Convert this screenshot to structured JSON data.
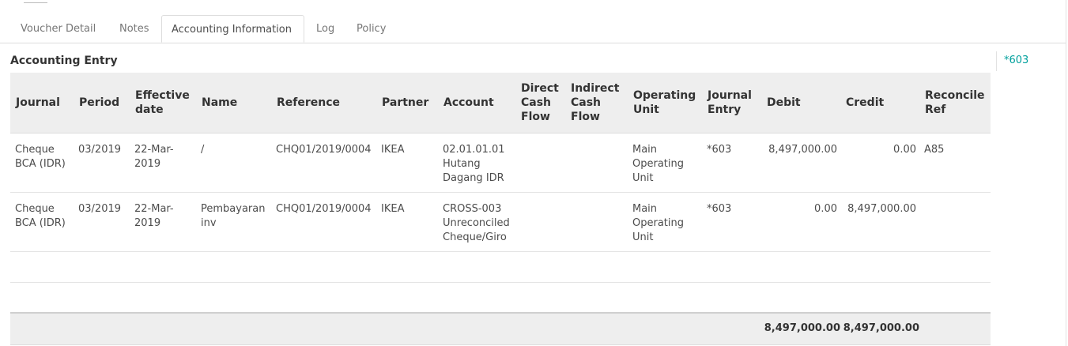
{
  "tabs": [
    {
      "label": "Voucher Detail",
      "active": false
    },
    {
      "label": "Notes",
      "active": false
    },
    {
      "label": "Accounting Information",
      "active": true
    },
    {
      "label": "Log",
      "active": false
    },
    {
      "label": "Policy",
      "active": false
    }
  ],
  "section_title": "Accounting Entry",
  "side_link": "*603",
  "columns": [
    "Journal",
    "Period",
    "Effective date",
    "Name",
    "Reference",
    "Partner",
    "Account",
    "Direct Cash Flow",
    "Indirect Cash Flow",
    "Operating Unit",
    "Journal Entry",
    "Debit",
    "Credit",
    "Reconcile Ref"
  ],
  "rows": [
    {
      "journal": "Cheque BCA (IDR)",
      "period": "03/2019",
      "effective_date": "22-Mar-2019",
      "name": "/",
      "reference": "CHQ01/2019/0004",
      "partner": "IKEA",
      "account": "02.01.01.01 Hutang Dagang IDR",
      "direct_cash_flow": "",
      "indirect_cash_flow": "",
      "operating_unit": "Main Operating Unit",
      "journal_entry": "*603",
      "debit": "8,497,000.00",
      "credit": "0.00",
      "reconcile_ref": "A85"
    },
    {
      "journal": "Cheque BCA (IDR)",
      "period": "03/2019",
      "effective_date": "22-Mar-2019",
      "name": "Pembayaran inv",
      "reference": "CHQ01/2019/0004",
      "partner": "IKEA",
      "account": "CROSS-003 Unreconciled Cheque/Giro",
      "direct_cash_flow": "",
      "indirect_cash_flow": "",
      "operating_unit": "Main Operating Unit",
      "journal_entry": "*603",
      "debit": "0.00",
      "credit": "8,497,000.00",
      "reconcile_ref": ""
    }
  ],
  "totals": {
    "debit": "8,497,000.00",
    "credit": "8,497,000.00"
  }
}
